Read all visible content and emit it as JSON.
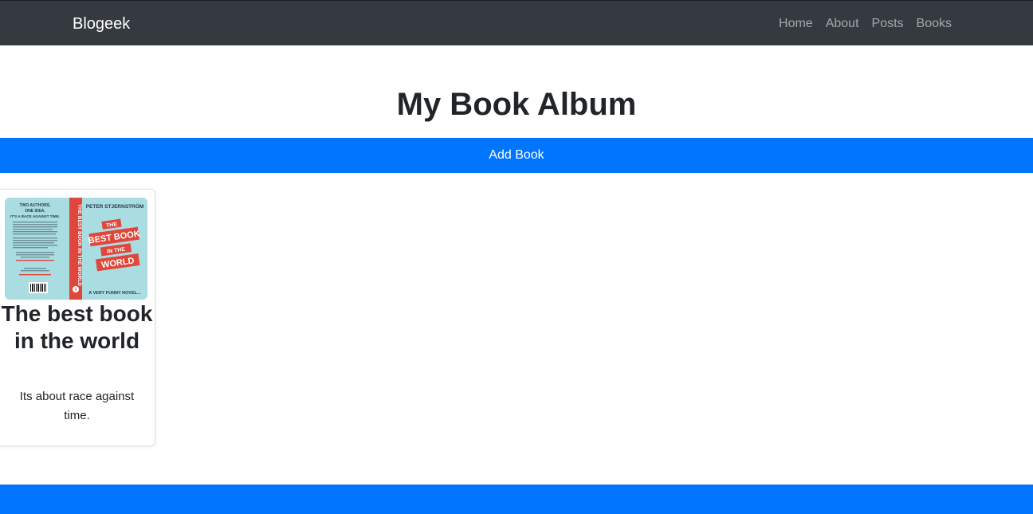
{
  "navbar": {
    "brand": "Blogeek",
    "links": [
      {
        "label": "Home"
      },
      {
        "label": "About"
      },
      {
        "label": "Posts"
      },
      {
        "label": "Books"
      }
    ]
  },
  "main": {
    "title": "My Book Album",
    "add_book_label": "Add Book"
  },
  "books": [
    {
      "title": "The best book in the world",
      "description": "Its about race against time.",
      "cover": {
        "author": "PETER STJERNSTRÖM",
        "spine_text": "THE BEST BOOK IN THE WORLD",
        "ribbon_words": [
          "THE",
          "BEST BOOK",
          "IN THE",
          "WORLD"
        ],
        "tagline": "A VERY FUNNY NOVEL...",
        "back_headline": [
          "TWO AUTHORS.",
          "ONE IDEA.",
          "IT'S A RACE AGAINST TIME."
        ]
      }
    }
  ],
  "colors": {
    "navbar_bg": "#343a40",
    "primary": "#0275ff",
    "cover_bg": "#a9dde2",
    "cover_red": "#e0473c",
    "cover_navy": "#2b3a4a"
  }
}
